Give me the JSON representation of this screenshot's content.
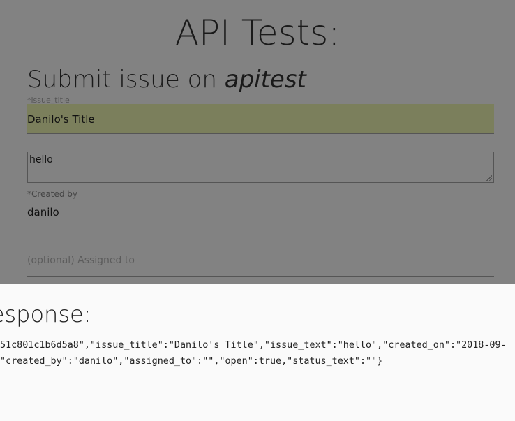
{
  "page": {
    "title": "API Tests:"
  },
  "form": {
    "heading_prefix": "Submit issue on ",
    "project": "apitest",
    "issue_title": {
      "label": "*issue_title",
      "value": "Danilo's Title"
    },
    "issue_text": {
      "value": "hello"
    },
    "created_by": {
      "label": "*Created by",
      "value": "danilo"
    },
    "assigned_to": {
      "placeholder": "(optional) Assigned to"
    }
  },
  "response": {
    "heading": "Response:",
    "line1": "51c801c1b6d5a8\",\"issue_title\":\"Danilo's Title\",\"issue_text\":\"hello\",\"created_on\":\"2018-09-",
    "line2": "\"created_by\":\"danilo\",\"assigned_to\":\"\",\"open\":true,\"status_text\":\"\"}"
  }
}
